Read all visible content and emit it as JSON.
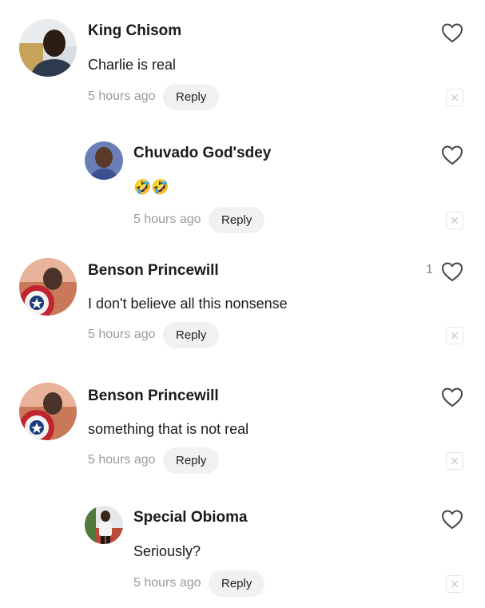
{
  "comments": [
    {
      "name": "King Chisom",
      "text": "Charlie is real",
      "time": "5 hours ago",
      "reply_label": "Reply",
      "likes": "",
      "avatar": "user-photo"
    },
    {
      "name": "Chuvado God'sdey",
      "text": "🤣🤣",
      "time": "5 hours ago",
      "reply_label": "Reply",
      "likes": "",
      "avatar": "user-photo"
    },
    {
      "name": "Benson Princewill",
      "text": "I don't believe all this nonsense",
      "time": "5 hours ago",
      "reply_label": "Reply",
      "likes": "1",
      "avatar": "captain-shield-photo"
    },
    {
      "name": "Benson Princewill",
      "text": "something that is not real",
      "time": "5 hours ago",
      "reply_label": "Reply",
      "likes": "",
      "avatar": "captain-shield-photo"
    },
    {
      "name": "Special Obioma",
      "text": "Seriously?",
      "time": "5 hours ago",
      "reply_label": "Reply",
      "likes": "",
      "avatar": "user-photo"
    }
  ],
  "icons": {
    "like": "heart-outline-icon",
    "dismiss": "close-x-icon"
  },
  "colors": {
    "background": "#ffffff",
    "name": "#1a1a1a",
    "meta": "#9b9b9b",
    "reply_bg": "#f1f1f1"
  }
}
